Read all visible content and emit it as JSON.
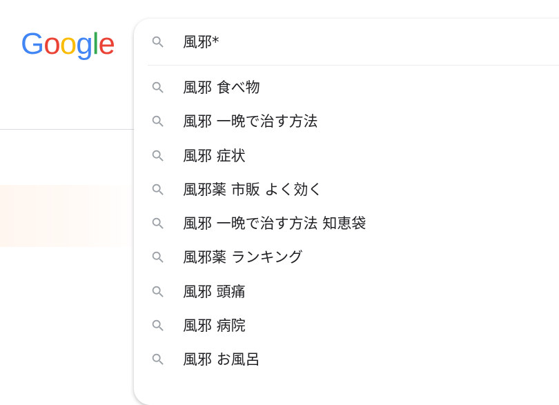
{
  "logo": {
    "letters": [
      "G",
      "o",
      "o",
      "g",
      "l",
      "e"
    ],
    "colors": [
      "#4285f4",
      "#ea4335",
      "#fbbc05",
      "#4285f4",
      "#34a853",
      "#ea4335"
    ]
  },
  "search": {
    "query": "風邪*",
    "icon": "search-icon"
  },
  "suggestions": [
    "風邪 食べ物",
    "風邪 一晩で治す方法",
    "風邪 症状",
    "風邪薬 市販 よく効く",
    "風邪 一晩で治す方法 知恵袋",
    "風邪薬 ランキング",
    "風邪 頭痛",
    "風邪 病院",
    "風邪 お風呂"
  ],
  "colors": {
    "text": "#202124",
    "icon": "#9aa0a6",
    "divider": "#e8eaed"
  }
}
